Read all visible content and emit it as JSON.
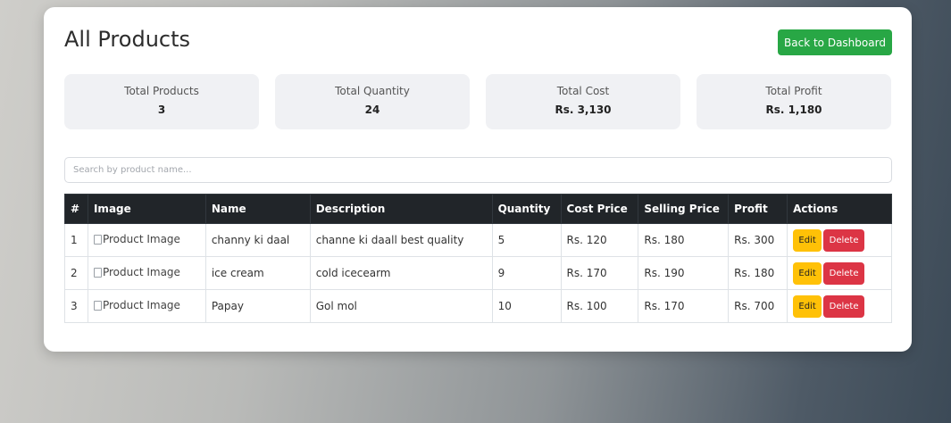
{
  "page": {
    "title": "All Products",
    "back_button_label": "Back to Dashboard"
  },
  "stats": [
    {
      "label": "Total Products",
      "value": "3"
    },
    {
      "label": "Total Quantity",
      "value": "24"
    },
    {
      "label": "Total Cost",
      "value": "Rs. 3,130"
    },
    {
      "label": "Total Profit",
      "value": "Rs. 1,180"
    }
  ],
  "search": {
    "placeholder": "Search by product name...",
    "value": ""
  },
  "table": {
    "headers": [
      "#",
      "Image",
      "Name",
      "Description",
      "Quantity",
      "Cost Price",
      "Selling Price",
      "Profit",
      "Actions"
    ],
    "rows": [
      {
        "index": "1",
        "image_alt": "Product Image",
        "name": "channy ki daal",
        "description": "channe ki daall best quality",
        "quantity": "5",
        "cost": "Rs. 120",
        "selling": "Rs. 180",
        "profit": "Rs. 300"
      },
      {
        "index": "2",
        "image_alt": "Product Image",
        "name": "ice cream",
        "description": "cold icecearm",
        "quantity": "9",
        "cost": "Rs. 170",
        "selling": "Rs. 190",
        "profit": "Rs. 180"
      },
      {
        "index": "3",
        "image_alt": "Product Image",
        "name": "Papay",
        "description": "Gol mol",
        "quantity": "10",
        "cost": "Rs. 100",
        "selling": "Rs. 170",
        "profit": "Rs. 700"
      }
    ],
    "edit_label": "Edit",
    "delete_label": "Delete"
  },
  "colors": {
    "primary_green": "#28a745",
    "edit_yellow": "#ffc107",
    "delete_red": "#dc3545",
    "table_header": "#212529"
  }
}
